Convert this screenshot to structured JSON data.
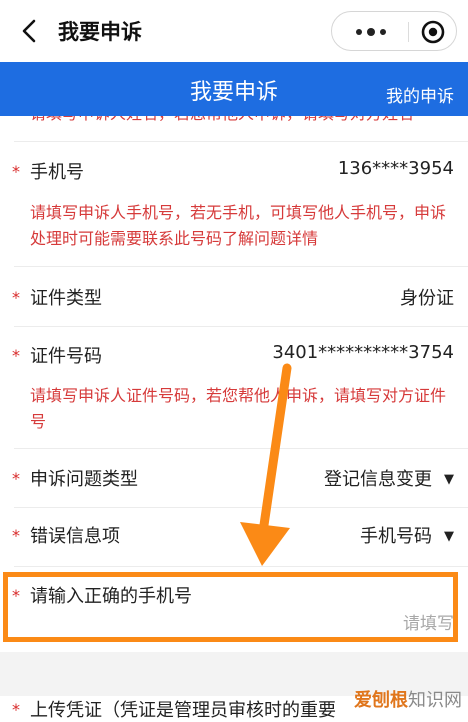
{
  "nav": {
    "title": "我要申诉"
  },
  "header": {
    "title": "我要申诉",
    "my_appeals": "我的申诉"
  },
  "top_hint_partial": "请填写申诉人姓名，若您帮他人申诉，请填写对方姓名",
  "fields": {
    "phone": {
      "label": "手机号",
      "value": "136****3954",
      "hint": "请填写申诉人手机号，若无手机，可填写他人手机号，申诉处理时可能需要联系此号码了解问题详情"
    },
    "id_type": {
      "label": "证件类型",
      "value": "身份证"
    },
    "id_number": {
      "label": "证件号码",
      "value": "3401**********3754",
      "hint": "请填写申诉人证件号码，若您帮他人申诉，请填写对方证件号"
    },
    "problem_type": {
      "label": "申诉问题类型",
      "value": "登记信息变更"
    },
    "wrong_item": {
      "label": "错误信息项",
      "value": "手机号码"
    },
    "correct_phone": {
      "label": "请输入正确的手机号",
      "placeholder": "请填写"
    },
    "upload": {
      "label": "上传凭证（凭证是管理员审核时的重要"
    }
  },
  "required_mark": "*",
  "dropdown_glyph": "▼",
  "watermark": {
    "brand": "爱刨根",
    "site": "知识网"
  },
  "colors": {
    "header_blue": "#1e6de1",
    "hint_red": "#d63a3a",
    "highlight_orange": "#fb8a16"
  }
}
